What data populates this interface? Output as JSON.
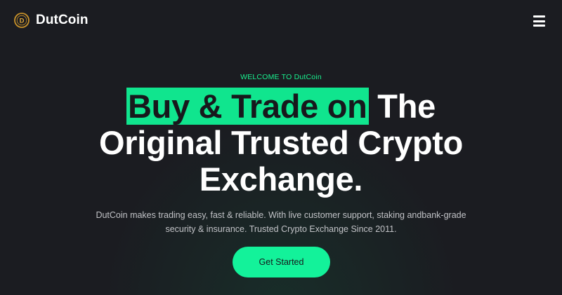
{
  "brand": {
    "name": "DutCoin",
    "logo_icon": "coin-d-logo-icon",
    "logo_color": "#c8922a"
  },
  "nav": {
    "menu_icon": "hamburger-menu-icon"
  },
  "hero": {
    "eyebrow": "WELCOME TO DutCoin",
    "headline_highlight": "Buy & Trade on",
    "headline_rest_line1": " The",
    "headline_line2": "Original Trusted Crypto",
    "headline_line3": "Exchange.",
    "description": "DutCoin makes trading easy, fast & reliable. With live customer support, staking andbank-grade security & insurance. Trusted Crypto Exchange Since 2011.",
    "cta_label": "Get Started"
  },
  "colors": {
    "background": "#1b1c21",
    "accent": "#13f29a",
    "text_primary": "#ffffff",
    "text_muted": "#c2c3c7"
  }
}
